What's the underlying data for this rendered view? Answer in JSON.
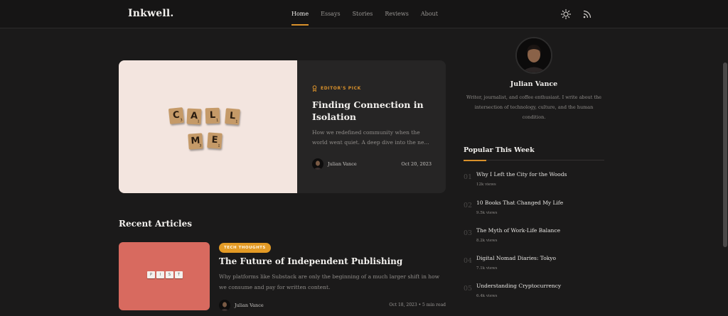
{
  "header": {
    "logo": "Inkwell.",
    "nav": [
      {
        "label": "Home",
        "active": true
      },
      {
        "label": "Essays",
        "active": false
      },
      {
        "label": "Stories",
        "active": false
      },
      {
        "label": "Reviews",
        "active": false
      },
      {
        "label": "About",
        "active": false
      }
    ],
    "icons": [
      "sun-icon",
      "rss-icon"
    ]
  },
  "hero": {
    "tiles": [
      {
        "letter": "C",
        "sub": "3"
      },
      {
        "letter": "A",
        "sub": "1"
      },
      {
        "letter": "L",
        "sub": "1"
      },
      {
        "letter": "L",
        "sub": "1"
      },
      {
        "letter": "M",
        "sub": "3"
      },
      {
        "letter": "E",
        "sub": "1"
      }
    ],
    "badge": "EDITOR'S PICK",
    "title": "Finding Connection in Isolation",
    "excerpt": "How we redefined community when the world went quiet. A deep dive into the ne...",
    "author": "Julian Vance",
    "date": "Oct 20, 2023"
  },
  "recent": {
    "heading": "Recent Articles",
    "articles": [
      {
        "tag": "TECH THOUGHTS",
        "title": "The Future of Independent Publishing",
        "excerpt": "Why platforms like Substack are only the beginning of a much larger shift in how we consume and pay for written content.",
        "author": "Julian Vance",
        "meta": "Oct 18, 2023 • 5 min read",
        "keys": [
          "P",
          "I",
          "S",
          "T"
        ]
      }
    ]
  },
  "profile": {
    "name": "Julian Vance",
    "bio": "Writer, journalist, and coffee enthusiast. I write about the intersection of technology, culture, and the human condition."
  },
  "popular": {
    "heading": "Popular This Week",
    "items": [
      {
        "num": "01",
        "title": "Why I Left the City for the Woods",
        "views": "12k views"
      },
      {
        "num": "02",
        "title": "10 Books That Changed My Life",
        "views": "9.5k views"
      },
      {
        "num": "03",
        "title": "The Myth of Work-Life Balance",
        "views": "8.2k views"
      },
      {
        "num": "04",
        "title": "Digital Nomad Diaries: Tokyo",
        "views": "7.1k views"
      },
      {
        "num": "05",
        "title": "Understanding Cryptocurrency",
        "views": "6.4k views"
      }
    ]
  },
  "colors": {
    "accent": "#d9912b",
    "background": "#1b1a1a",
    "card": "#262525"
  }
}
